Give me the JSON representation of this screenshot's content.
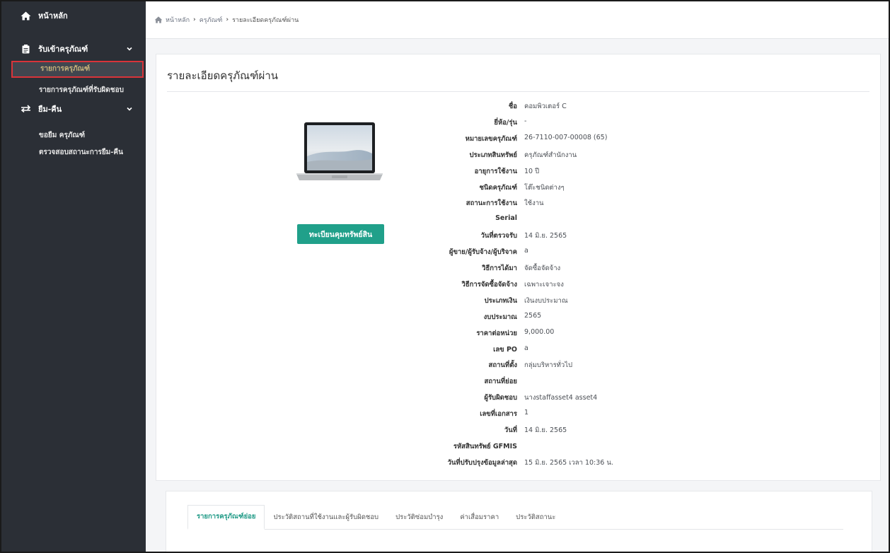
{
  "sidebar": {
    "home": "หน้าหลัก",
    "receive": "รับเข้าครุภัณฑ์",
    "receive_items": [
      "รายการครุภัณฑ์",
      "รายการครุภัณฑ์ที่รับผิดชอบ"
    ],
    "borrow": "ยืม-คืน",
    "borrow_items": [
      "ขอยืม ครุภัณฑ์",
      "ตรวจสอบสถานะการยืม-คืน"
    ],
    "active_item": "รายการครุภัณฑ์",
    "accent_color": "#d9343a"
  },
  "breadcrumb": [
    "หน้าหลัก",
    "ครุภัณฑ์",
    "รายละเอียดครุภัณฑ์ผ่าน"
  ],
  "page": {
    "title": "รายละเอียดครุภัณฑ์ผ่าน",
    "register_button": "ทะเบียนคุมทรัพย์สิน",
    "button_color": "#20a08a"
  },
  "details": [
    {
      "label": "ชื่อ",
      "value": "คอมพิวเตอร์ C"
    },
    {
      "label": "ยี่ห้อ/รุ่น",
      "value": "-"
    },
    {
      "label": "หมายเลขครุภัณฑ์",
      "value": "26-7110-007-00008 (65)"
    },
    {
      "label": "ประเภทสินทรัพย์",
      "value": "ครุภัณฑ์สำนักงาน"
    },
    {
      "label": "อายุการใช้งาน",
      "value": "10 ปี"
    },
    {
      "label": "ชนิดครุภัณฑ์",
      "value": "โต๊ะชนิดต่างๆ"
    },
    {
      "label": "สถานะการใช้งาน",
      "value": "ใช้งาน"
    },
    {
      "label": "Serial",
      "value": ""
    },
    {
      "label": "วันที่ตรวจรับ",
      "value": "14 มิ.ย. 2565"
    },
    {
      "label": "ผู้ขาย/ผู้รับจ้าง/ผู้บริจาค",
      "value": "a"
    },
    {
      "label": "วิธีการได้มา",
      "value": "จัดซื้อจัดจ้าง"
    },
    {
      "label": "วิธีการจัดซื้อจัดจ้าง",
      "value": "เฉพาะเจาะจง"
    },
    {
      "label": "ประเภทเงิน",
      "value": "เงินงบประมาณ"
    },
    {
      "label": "งบประมาณ",
      "value": "2565"
    },
    {
      "label": "ราคาต่อหน่วย",
      "value": "9,000.00"
    },
    {
      "label": "เลข PO",
      "value": "a"
    },
    {
      "label": "สถานที่ตั้ง",
      "value": "กลุ่มบริหารทั่วไป"
    },
    {
      "label": "สถานที่ย่อย",
      "value": ""
    },
    {
      "label": "ผู้รับผิดชอบ",
      "value": "นางstaffasset4 asset4"
    },
    {
      "label": "เลขที่เอกสาร",
      "value": "1"
    },
    {
      "label": "วันที่",
      "value": "14 มิ.ย. 2565"
    },
    {
      "label": "รหัสสินทรัพย์ GFMIS",
      "value": ""
    },
    {
      "label": "วันที่ปรับปรุงข้อมูลล่าสุด",
      "value": "15 มิ.ย. 2565 เวลา 10:36 น."
    }
  ],
  "tabs": [
    "รายการครุภัณฑ์ย่อย",
    "ประวัติสถานที่ใช้งานและผู้รับผิดชอบ",
    "ประวัติซ่อมบำรุง",
    "ค่าเสื่อมราคา",
    "ประวัติสถานะ"
  ],
  "active_tab": "รายการครุภัณฑ์ย่อย",
  "icons": {
    "home": "home-icon",
    "receive": "clipboard-icon",
    "borrow": "exchange-icon",
    "chevron": "chevron-down-icon"
  }
}
